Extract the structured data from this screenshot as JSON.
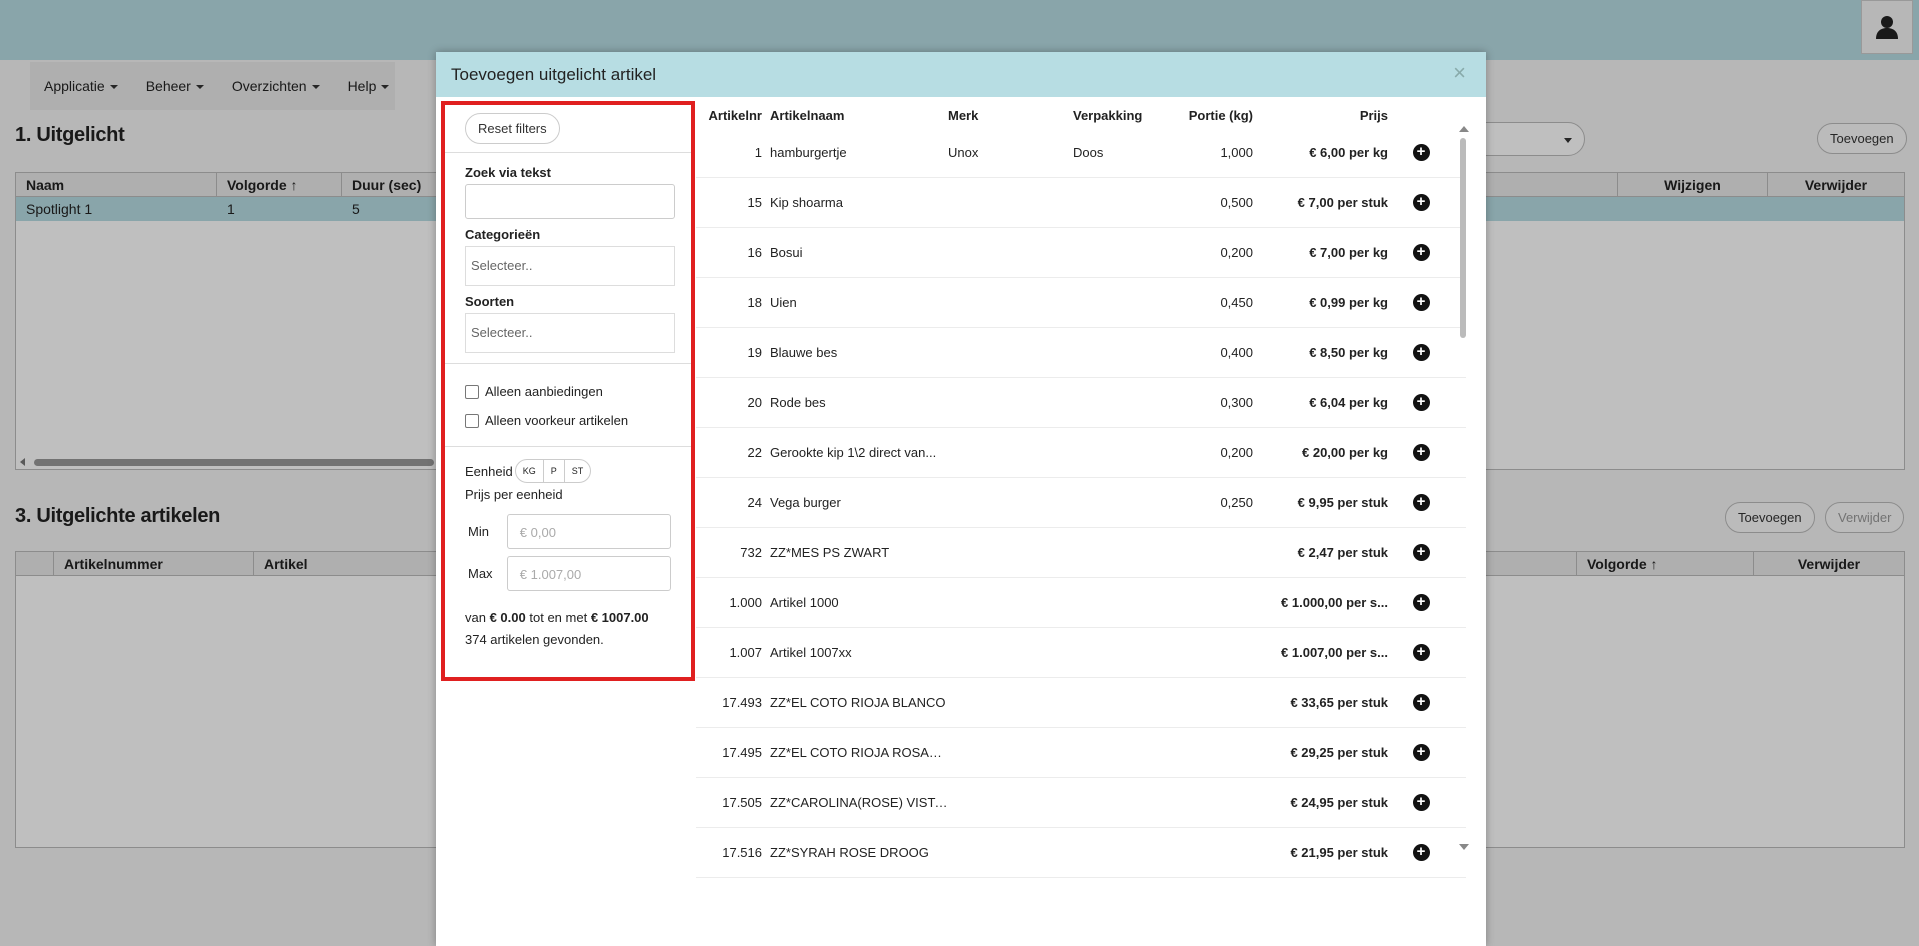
{
  "menu": [
    {
      "label": "Applicatie"
    },
    {
      "label": "Beheer"
    },
    {
      "label": "Overzichten"
    },
    {
      "label": "Help"
    }
  ],
  "section1": {
    "title": "1. Uitgelicht",
    "add_label": "Toevoegen",
    "columns": [
      "Naam",
      "Volgorde",
      "Duur (sec)",
      "Wijzigen",
      "Verwijder"
    ],
    "row": {
      "naam": "Spotlight 1",
      "volgorde": "1",
      "duur": "5"
    }
  },
  "section3": {
    "title": "3. Uitgelichte artikelen",
    "add_label": "Toevoegen",
    "delete_label": "Verwijder",
    "columns": [
      "Artikelnummer",
      "Artikel",
      "Volgorde",
      "Verwijder"
    ]
  },
  "modal": {
    "title": "Toevoegen uitgelicht artikel",
    "close_glyph": "×",
    "filters": {
      "reset_label": "Reset filters",
      "search_label": "Zoek via tekst",
      "categories_label": "Categorieën",
      "categories_placeholder": "Selecteer..",
      "kinds_label": "Soorten",
      "kinds_placeholder": "Selecteer..",
      "only_offers": "Alleen aanbiedingen",
      "only_preferred": "Alleen voorkeur artikelen",
      "unit_label": "Eenheid",
      "units": [
        "KG",
        "P",
        "ST"
      ],
      "price_per_unit": "Prijs per eenheid",
      "min_label": "Min",
      "min_placeholder": "€ 0,00",
      "max_label": "Max",
      "max_placeholder": "€ 1.007,00",
      "summary_from": "van",
      "summary_min": "€ 0.00",
      "summary_mid": "tot en met",
      "summary_max": "€ 1007.00",
      "summary_count": "374 artikelen gevonden."
    },
    "columns": {
      "nr": "Artikelnr",
      "name": "Artikelnaam",
      "merk": "Merk",
      "verpakking": "Verpakking",
      "portie": "Portie (kg)",
      "prijs": "Prijs"
    },
    "rows": [
      {
        "nr": "1",
        "name": "hamburgertje",
        "merk": "Unox",
        "verpakking": "Doos",
        "portie": "1,000",
        "prijs": "€ 6,00 per kg"
      },
      {
        "nr": "15",
        "name": "Kip shoarma",
        "merk": "",
        "verpakking": "",
        "portie": "0,500",
        "prijs": "€ 7,00 per stuk"
      },
      {
        "nr": "16",
        "name": "Bosui",
        "merk": "",
        "verpakking": "",
        "portie": "0,200",
        "prijs": "€ 7,00 per kg"
      },
      {
        "nr": "18",
        "name": "Uien",
        "merk": "",
        "verpakking": "",
        "portie": "0,450",
        "prijs": "€ 0,99 per kg"
      },
      {
        "nr": "19",
        "name": "Blauwe bes",
        "merk": "",
        "verpakking": "",
        "portie": "0,400",
        "prijs": "€ 8,50 per kg"
      },
      {
        "nr": "20",
        "name": "Rode bes",
        "merk": "",
        "verpakking": "",
        "portie": "0,300",
        "prijs": "€ 6,04 per kg"
      },
      {
        "nr": "22",
        "name": "Gerookte kip 1\\2 direct van...",
        "merk": "",
        "verpakking": "",
        "portie": "0,200",
        "prijs": "€ 20,00 per kg"
      },
      {
        "nr": "24",
        "name": "Vega burger",
        "merk": "",
        "verpakking": "",
        "portie": "0,250",
        "prijs": "€ 9,95 per stuk"
      },
      {
        "nr": "732",
        "name": "ZZ*MES PS ZWART",
        "merk": "",
        "verpakking": "",
        "portie": "",
        "prijs": "€ 2,47 per stuk"
      },
      {
        "nr": "1.000",
        "name": "Artikel 1000",
        "merk": "",
        "verpakking": "",
        "portie": "",
        "prijs": "€ 1.000,00 per s..."
      },
      {
        "nr": "1.007",
        "name": "Artikel 1007xx",
        "merk": "",
        "verpakking": "",
        "portie": "",
        "prijs": "€ 1.007,00 per s..."
      },
      {
        "nr": "17.493",
        "name": "ZZ*EL COTO RIOJA BLANCO",
        "merk": "",
        "verpakking": "",
        "portie": "",
        "prijs": "€ 33,65 per stuk"
      },
      {
        "nr": "17.495",
        "name": "ZZ*EL COTO RIOJA ROSAD...",
        "merk": "",
        "verpakking": "",
        "portie": "",
        "prijs": "€ 29,25 per stuk"
      },
      {
        "nr": "17.505",
        "name": "ZZ*CAROLINA(ROSE) VISTA...",
        "merk": "",
        "verpakking": "",
        "portie": "",
        "prijs": "€ 24,95 per stuk"
      },
      {
        "nr": "17.516",
        "name": "ZZ*SYRAH ROSE DROOG",
        "merk": "",
        "verpakking": "",
        "portie": "",
        "prijs": "€ 21,95 per stuk"
      }
    ]
  }
}
